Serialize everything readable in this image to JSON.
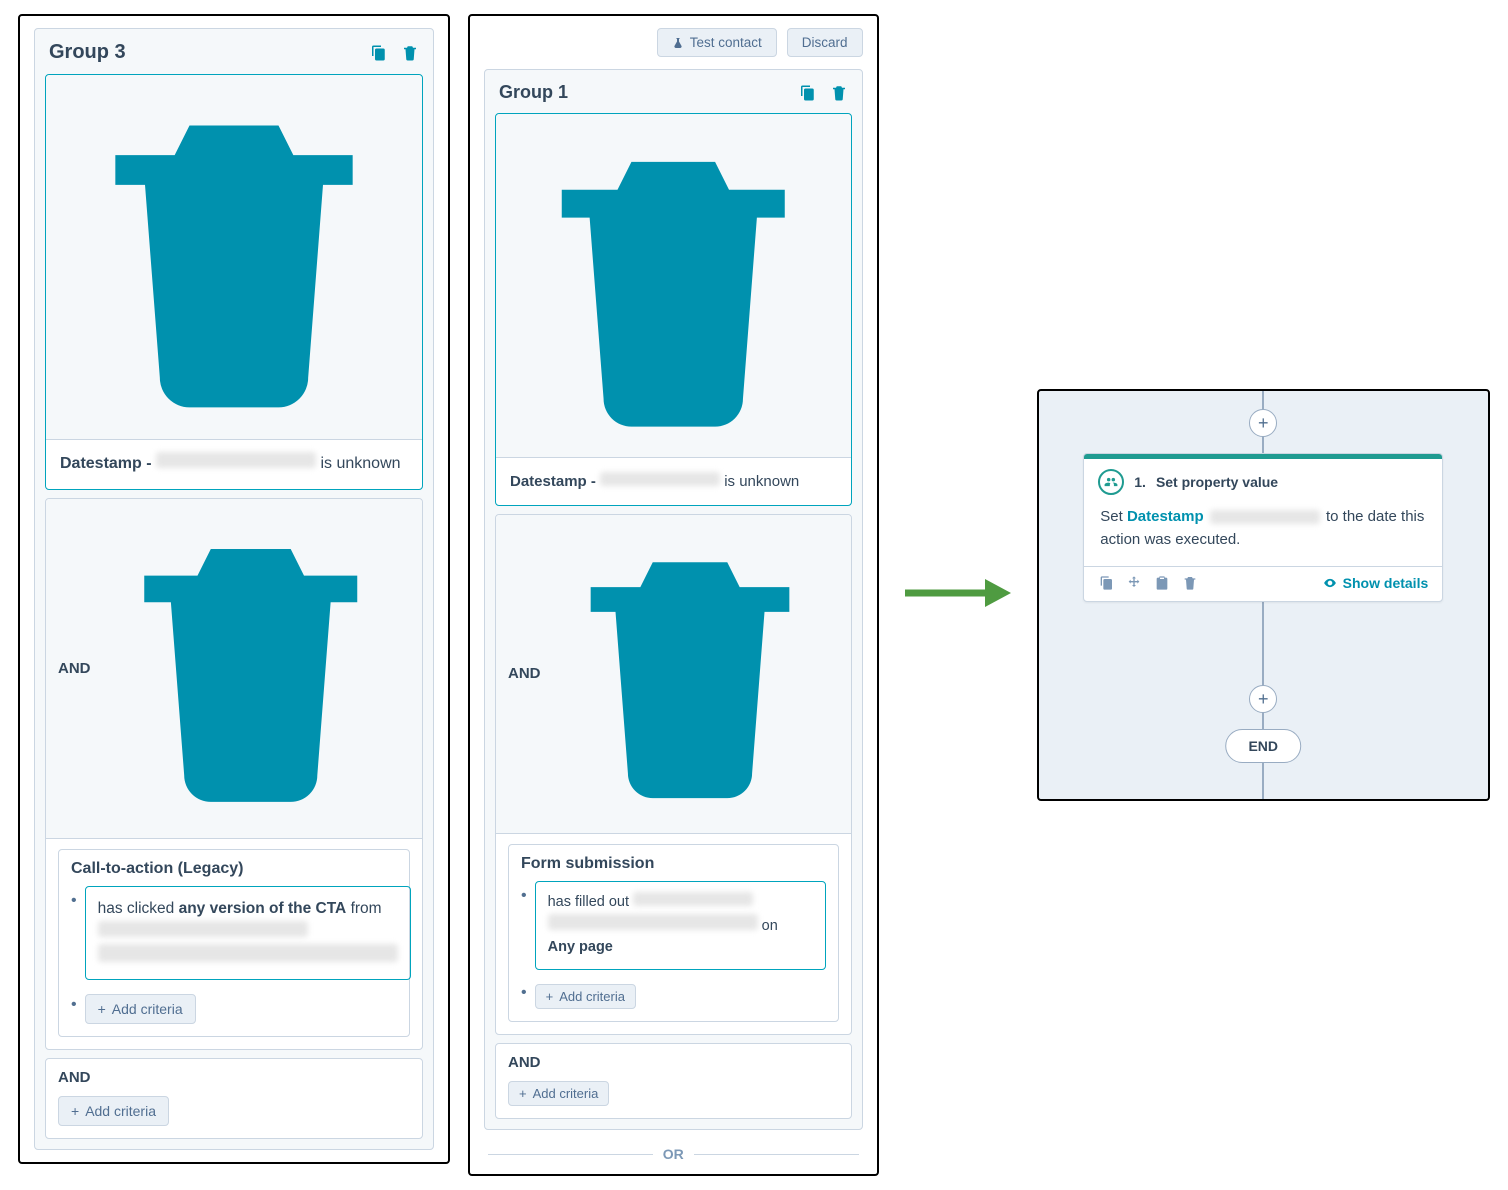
{
  "left": {
    "group_title": "Group 3",
    "filter1": {
      "prefix": "Datestamp - ",
      "suffix": " is unknown"
    },
    "and_label": "AND",
    "sub_title": "Call-to-action (Legacy)",
    "criteria_before": "has clicked ",
    "criteria_bold": "any version of the CTA",
    "criteria_from": " from ",
    "add_criteria": "Add criteria"
  },
  "mid": {
    "test_btn": "Test contact",
    "discard_btn": "Discard",
    "group_title": "Group 1",
    "filter1": {
      "prefix": "Datestamp - ",
      "suffix": " is unknown"
    },
    "and_label": "AND",
    "sub_title": "Form submission",
    "criteria_before": "has filled out ",
    "criteria_on": " on ",
    "criteria_anypage": "Any page",
    "add_criteria": "Add criteria",
    "or_label": "OR"
  },
  "right": {
    "step_index": "1.",
    "step_title": "Set property value",
    "body_before": "Set ",
    "body_link": "Datestamp",
    "body_after1": " to the date this action was executed.",
    "show_details": "Show details",
    "end_label": "END"
  }
}
